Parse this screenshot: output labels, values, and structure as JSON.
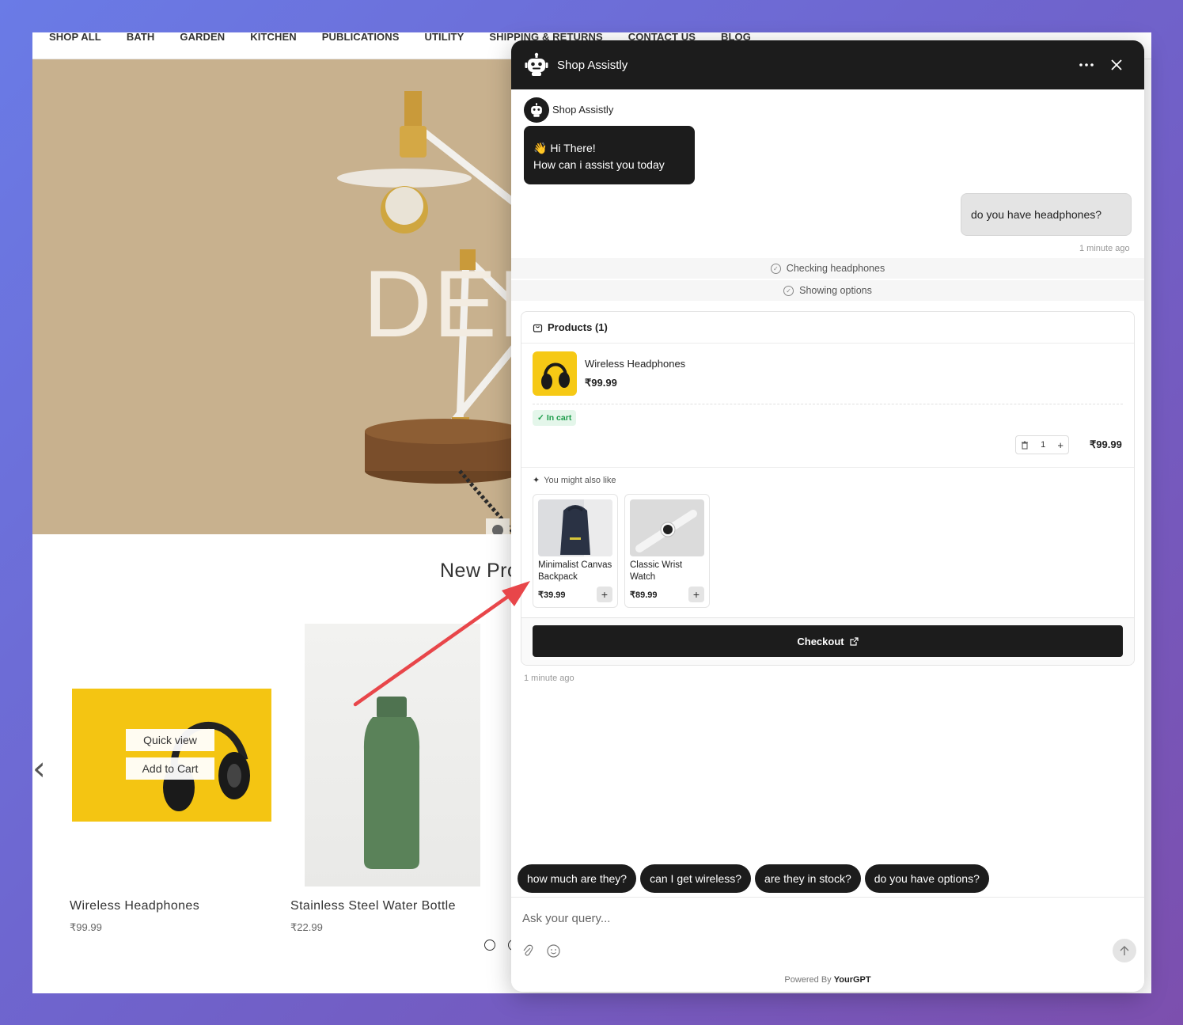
{
  "store": {
    "nav": [
      "SHOP ALL",
      "BATH",
      "GARDEN",
      "KITCHEN",
      "PUBLICATIONS",
      "UTILITY",
      "SHIPPING & RETURNS",
      "CONTACT US",
      "BLOG"
    ],
    "hero_text": "DEM",
    "section_title": "New Products",
    "quick_view_label": "Quick view",
    "add_to_cart_label": "Add to Cart",
    "products": [
      {
        "name": "Wireless Headphones",
        "price": "₹99.99"
      },
      {
        "name": "Stainless Steel Water Bottle",
        "price": "₹22.99"
      }
    ]
  },
  "chat": {
    "title": "Shop Assistly",
    "bot_name": "Shop Assistly",
    "greeting_line1": "👋 Hi There!",
    "greeting_line2": "How can i assist you today",
    "user_message": "do you have headphones?",
    "user_timestamp": "1 minute ago",
    "status_steps": [
      "Checking headphones",
      "Showing options"
    ],
    "products_header": "Products (1)",
    "cart_item": {
      "name": "Wireless Headphones",
      "price": "₹99.99",
      "badge": "In cart",
      "quantity": "1",
      "line_total": "₹99.99"
    },
    "recommend_title": "You might also like",
    "recommendations": [
      {
        "name": "Minimalist Canvas Backpack",
        "price": "₹39.99"
      },
      {
        "name": "Classic Wrist Watch",
        "price": "₹89.99"
      }
    ],
    "checkout_label": "Checkout",
    "bot_timestamp": "1 minute ago",
    "suggestions": [
      "how much are they?",
      "can I get wireless?",
      "are they in stock?",
      "do you have options?"
    ],
    "input_placeholder": "Ask your query...",
    "powered_prefix": "Powered By",
    "powered_brand": "YourGPT"
  },
  "colors": {
    "chat_dark": "#1c1c1c",
    "in_cart_green": "#1f9d4c",
    "annotation_arrow": "#e8464a",
    "hero_bg": "#c8b18e",
    "headphone_yellow": "#f4c512"
  },
  "icons": [
    "robot-icon",
    "more-icon",
    "close-icon",
    "check-circle-icon",
    "bag-icon",
    "check-icon",
    "trash-icon",
    "plus-icon",
    "sparkle-icon",
    "external-link-icon",
    "attachment-icon",
    "emoji-icon",
    "arrow-up-icon",
    "chevron-left-icon"
  ]
}
